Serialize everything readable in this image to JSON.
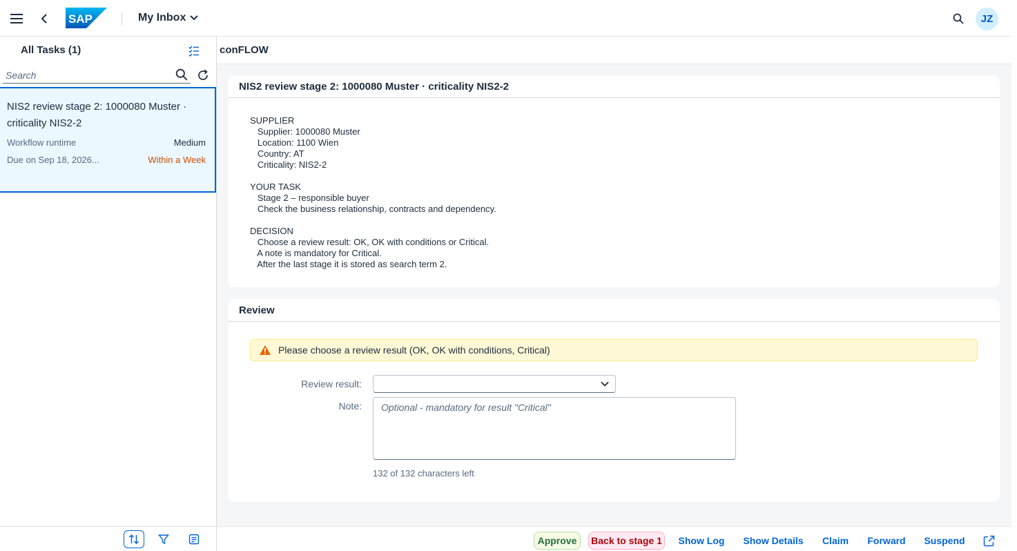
{
  "shell": {
    "title": "My Inbox",
    "avatar_initials": "JZ",
    "logo_text": "SAP",
    "logo_color": "#0a6ed1"
  },
  "left": {
    "title": "All Tasks (1)",
    "search_placeholder": "Search",
    "task": {
      "title": "NIS2 review stage 2: 1000080 Muster · criticality NIS2-2",
      "type": "Workflow runtime",
      "priority": "Medium",
      "due": "Due on Sep 18, 2026...",
      "due_status": "Within a Week"
    }
  },
  "detail": {
    "app_title": "conFLOW",
    "card1_title": "NIS2 review stage 2: 1000080 Muster · criticality NIS2-2",
    "description": "SUPPLIER\n   Supplier: 1000080 Muster\n   Location: 1100 Wien\n   Country: AT\n   Criticality: NIS2-2\n\nYOUR TASK\n   Stage 2 – responsible buyer\n   Check the business relationship, contracts and dependency.\n\nDECISION\n   Choose a review result: OK, OK with conditions or Critical.\n   A note is mandatory for Critical.\n   After the last stage it is stored as search term 2.",
    "card2_title": "Review",
    "warning": "Please choose a review result (OK, OK with conditions, Critical)",
    "review_result_label": "Review result:",
    "review_result_value": "",
    "note_label": "Note:",
    "note_placeholder": "Optional - mandatory for result \"Critical\"",
    "char_count": "132 of 132 characters left"
  },
  "footer": {
    "approve": "Approve",
    "back": "Back to stage 1",
    "show_log": "Show Log",
    "show_details": "Show Details",
    "claim": "Claim",
    "forward": "Forward",
    "suspend": "Suspend"
  },
  "colors": {
    "accent": "#0064d9",
    "warning": "#e76500",
    "selected_bg": "#ebf8ff"
  }
}
